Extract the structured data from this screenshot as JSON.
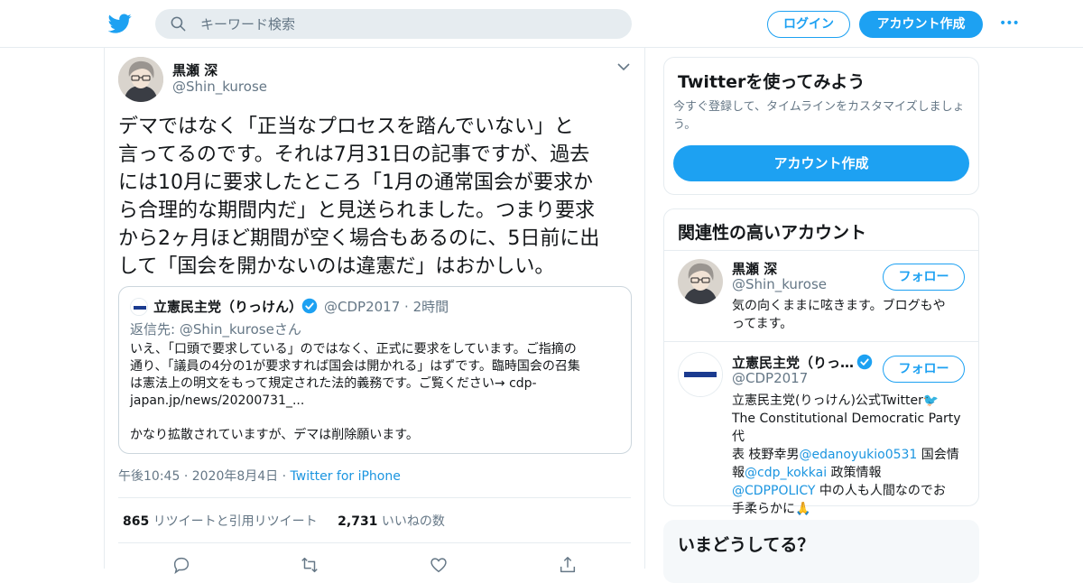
{
  "header": {
    "search_placeholder": "キーワード検索",
    "login_label": "ログイン",
    "signup_label": "アカウント作成",
    "more_label": "•••"
  },
  "tweet": {
    "display_name": "黒瀬 深",
    "handle": "@Shin_kurose",
    "lines": [
      "デマではなく「正当なプロセスを踏んでいない」と",
      "言ってるのです。それは7月31日の記事ですが、過去",
      "には10月に要求したところ「1月の通常国会が要求か",
      "ら合理的な期間内だ」と見送られました。つまり要求",
      "から2ヶ月ほど期間が空く場合もあるのに、5日前に出",
      "して「国会を開かないのは違憲だ」はおかしい。"
    ],
    "quote": {
      "name": "立憲民主党（りっけん）",
      "handle": "@CDP2017",
      "time": "· 2時間",
      "reply_prefix": "返信先:",
      "reply_to": "@Shin_kuroseさん",
      "lines": [
        "いえ、「口頭で要求している」のではなく、正式に要求をしています。ご指摘の",
        "通り、「議員の4分の1が要求すれば国会は開かれる」はずです。臨時国会の召集",
        "は憲法上の明文をもって規定された法的義務です。ご覧ください→ cdp-",
        "japan.jp/news/20200731_...",
        "",
        "かなり拡散されていますが、デマは削除願います。"
      ]
    },
    "time": "午後10:45",
    "date": "2020年8月4日",
    "source": "Twitter for iPhone",
    "retweets": "865",
    "retweets_label": "リツイートと引用リツイート",
    "likes": "2,731",
    "likes_label": "いいねの数"
  },
  "sidebar": {
    "signup_card": {
      "title": "Twitterを使ってみよう",
      "desc": "今すぐ登録して、タイムラインをカスタマイズしましょう。",
      "button": "アカウント作成"
    },
    "related": {
      "title": "関連性の高いアカウント",
      "follow_label": "フォロー",
      "accounts": [
        {
          "name": "黒瀬 深",
          "handle": "@Shin_kurose",
          "bio_lines": [
            "気の向くままに呟きます。ブログもや",
            "ってます。"
          ]
        },
        {
          "name": "立憲民主党（りっ…",
          "handle": "@CDP2017",
          "bio_1": "立憲民主党(りっけん)公式Twitter🐦",
          "bio_2": "The Constitutional Democratic Party 代",
          "bio_3a": "表 枝野幸男",
          "bio_3b": "@edanoyukio0531",
          "bio_3c": " 国会情",
          "bio_4a": "報",
          "bio_4b": "@cdp_kokkai",
          "bio_4c": " 政策情報",
          "bio_5a": "@CDPPOLICY",
          "bio_5b": " 中の人も人間なのでお",
          "bio_6": "手柔らかに🙏"
        }
      ]
    },
    "trends_title": "いまどうしてる？"
  },
  "colors": {
    "accent": "#1da1f2",
    "link": "#1b95e0",
    "secondary_text": "#657786",
    "border": "#e6ecf0"
  }
}
